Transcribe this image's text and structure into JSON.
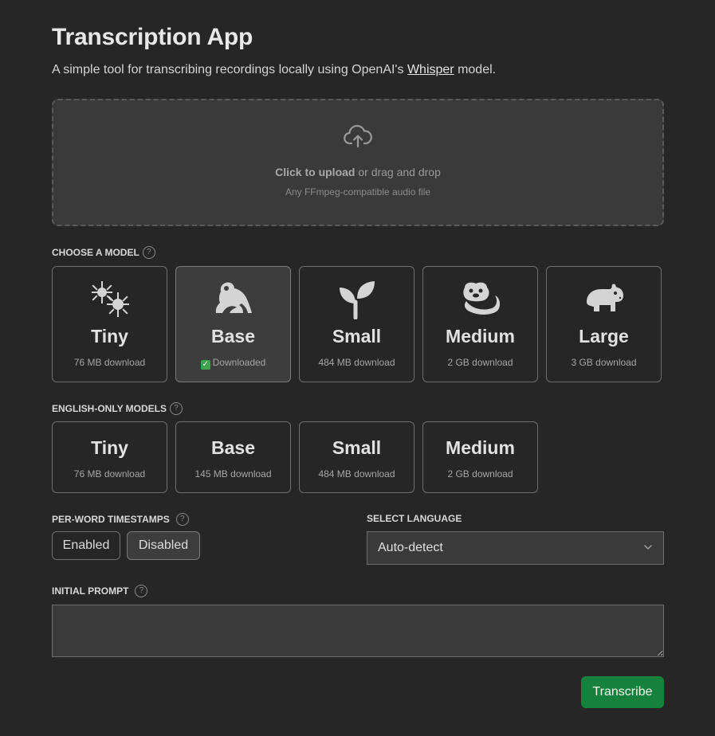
{
  "header": {
    "title": "Transcription App",
    "subtitle_before": "A simple tool for transcribing recordings locally using OpenAI's ",
    "subtitle_link": "Whisper",
    "subtitle_after": " model."
  },
  "upload": {
    "click_text": "Click to upload",
    "drag_text": " or drag and drop",
    "hint": "Any FFmpeg-compatible audio file",
    "icon": "cloud-upload-icon"
  },
  "models": {
    "label": "CHOOSE A MODEL",
    "selected": "Base",
    "items": [
      {
        "name": "Tiny",
        "sub": "76 MB download",
        "icon": "microbe-icon"
      },
      {
        "name": "Base",
        "sub": "Downloaded",
        "icon": "frog-icon"
      },
      {
        "name": "Small",
        "sub": "484 MB download",
        "icon": "seedling-icon"
      },
      {
        "name": "Medium",
        "sub": "2 GB download",
        "icon": "otter-icon"
      },
      {
        "name": "Large",
        "sub": "3 GB download",
        "icon": "hippo-icon"
      }
    ]
  },
  "english_models": {
    "label": "ENGLISH-ONLY MODELS",
    "items": [
      {
        "name": "Tiny",
        "sub": "76 MB download"
      },
      {
        "name": "Base",
        "sub": "145 MB download"
      },
      {
        "name": "Small",
        "sub": "484 MB download"
      },
      {
        "name": "Medium",
        "sub": "2 GB download"
      }
    ]
  },
  "timestamps": {
    "label": "PER-WORD TIMESTAMPS",
    "enabled_label": "Enabled",
    "disabled_label": "Disabled",
    "selected": "Disabled"
  },
  "language": {
    "label": "SELECT LANGUAGE",
    "value": "Auto-detect"
  },
  "prompt": {
    "label": "INITIAL PROMPT",
    "value": ""
  },
  "actions": {
    "transcribe_label": "Transcribe"
  },
  "colors": {
    "background": "#262626",
    "accent": "#16803d",
    "card_selected": "#3d3d3d"
  }
}
